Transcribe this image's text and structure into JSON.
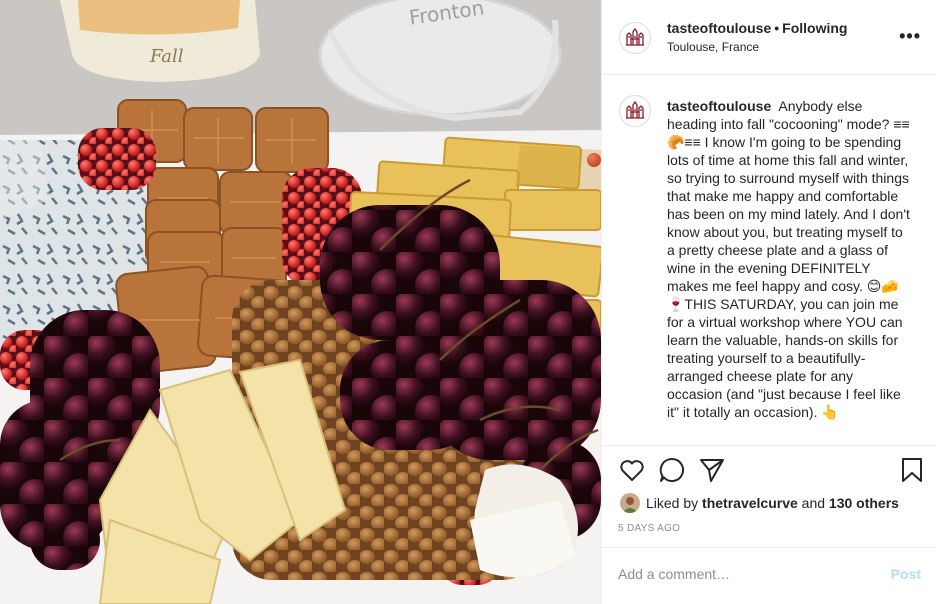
{
  "post": {
    "author": {
      "username": "tasteoftoulouse",
      "follow_status": "Following",
      "separator": "•",
      "location": "Toulouse, France"
    },
    "more_glyph": "•••",
    "caption": {
      "username": "tasteoftoulouse",
      "text": "Anybody else heading into fall \"cocooning\" mode? ≡≡🥐≡≡ I know I'm going to be spending lots of time at home this fall and winter, so trying to surround myself with things that make me happy and comfortable has been on my mind lately. And I don't know about you, but treating myself to a pretty cheese plate and a glass of wine in the evening DEFINITELY makes me feel happy and cosy. 😊🧀 🍷THIS SATURDAY, you can join me for a virtual workshop where YOU can learn the valuable, hands-on skills for treating yourself to a beautifully-arranged cheese plate for any occasion (and \"just because I feel like it\" it totally an occasion). 👆"
    },
    "actions": {
      "like_icon": "heart-icon",
      "comment_icon": "comment-icon",
      "share_icon": "share-icon",
      "save_icon": "bookmark-icon"
    },
    "likes": {
      "prefix": "Liked by",
      "liker": "thetravelcurve",
      "conjunction": "and",
      "others": "130 others"
    },
    "timestamp": "5 DAYS AGO",
    "comment_box": {
      "placeholder": "Add a comment…",
      "post_label": "Post"
    },
    "colors": {
      "post_button": "#b3dbff",
      "muted_text": "#8e8e8e",
      "border": "#efefef"
    }
  }
}
